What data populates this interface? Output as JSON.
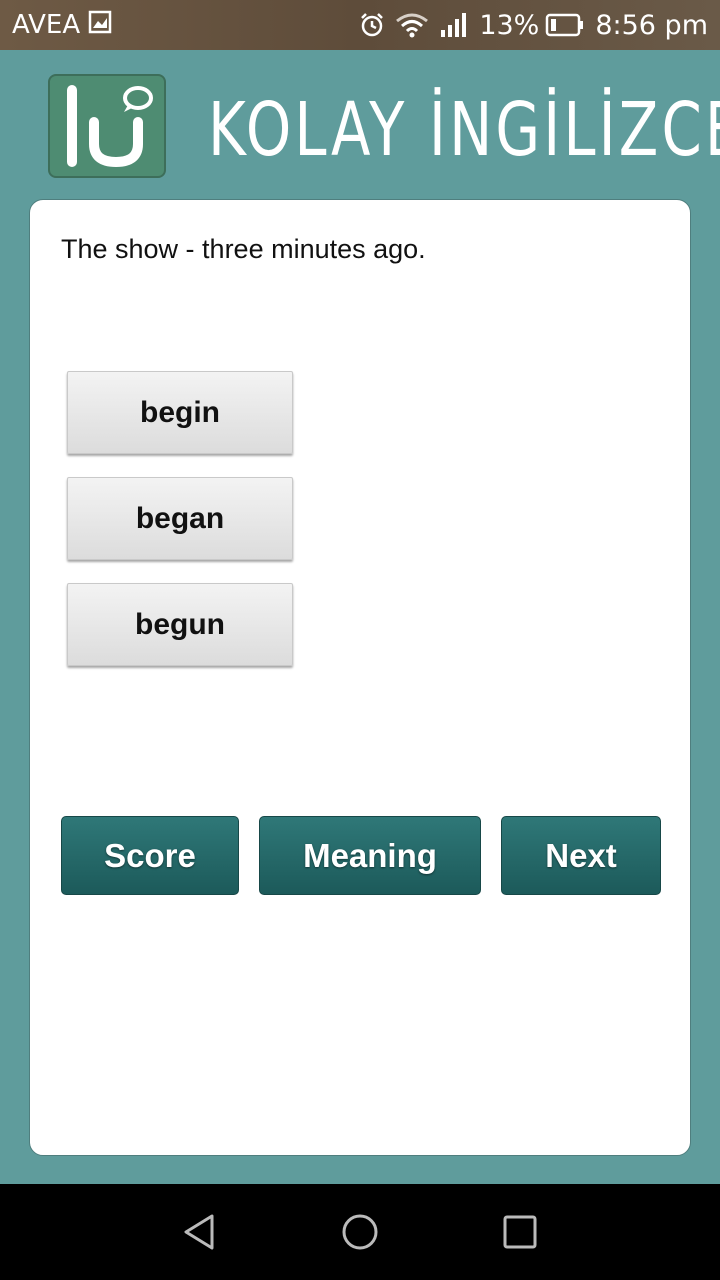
{
  "status_bar": {
    "carrier": "AVEA",
    "battery": "13%",
    "time": "8:56 pm",
    "icons": [
      "gallery-icon",
      "alarm-icon",
      "wifi-icon",
      "signal-icon",
      "battery-icon"
    ]
  },
  "header": {
    "logo_text": "ki",
    "title": "KOLAY İNGİLİZCE"
  },
  "question": {
    "text": "The show - three minutes ago."
  },
  "options": [
    "begin",
    "began",
    "begun"
  ],
  "actions": {
    "score": "Score",
    "meaning": "Meaning",
    "next": "Next"
  },
  "nav": {
    "icons": [
      "back-icon",
      "home-icon",
      "recent-apps-icon"
    ]
  },
  "colors": {
    "background": "#5f9c9c",
    "action_button": "#246868",
    "logo": "#4e8c72"
  }
}
